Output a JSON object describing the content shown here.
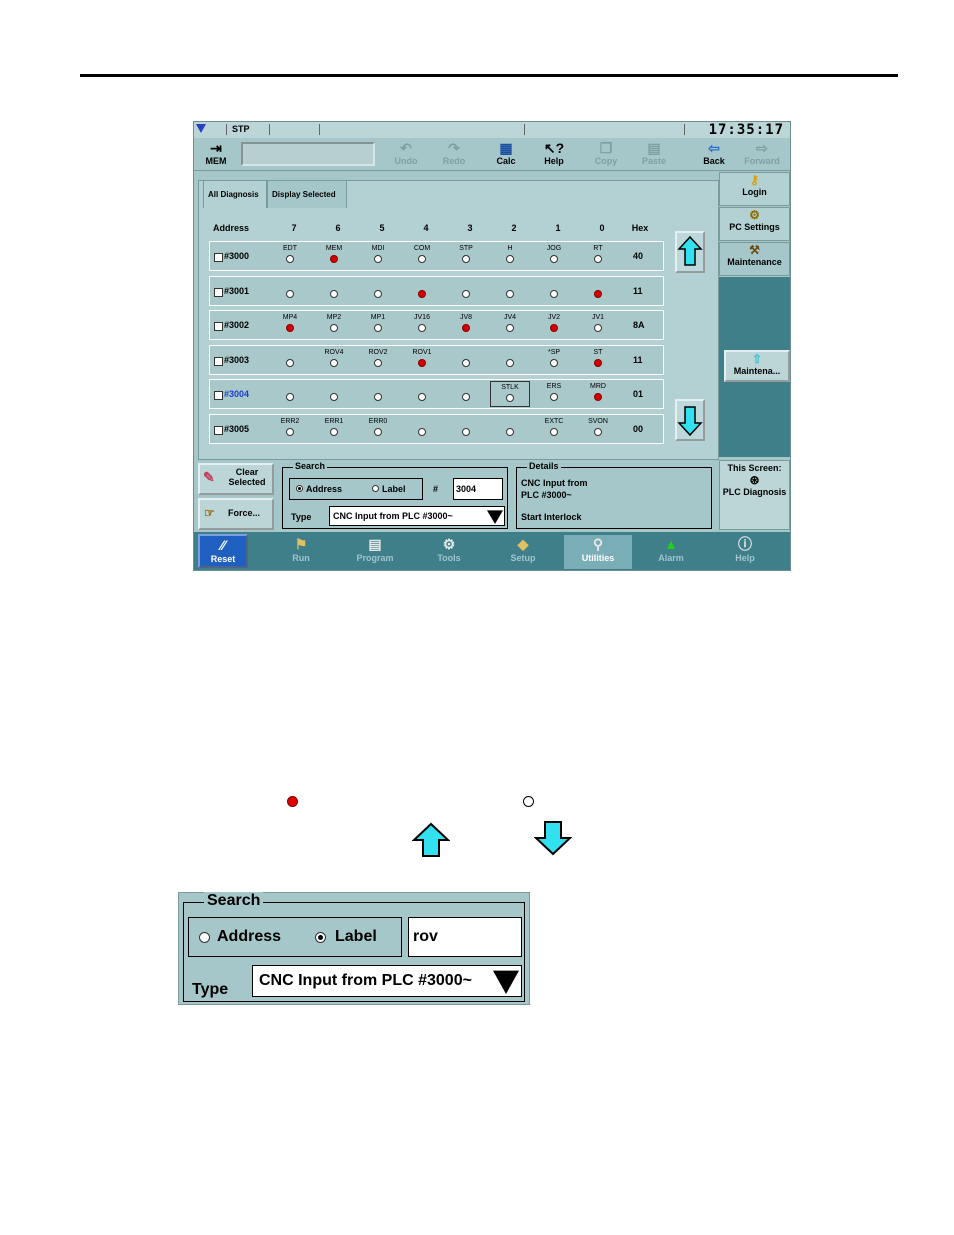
{
  "status": {
    "mode": "STP",
    "clock": "17:35:17"
  },
  "toolbar": {
    "mem": "MEM",
    "undo": "Undo",
    "redo": "Redo",
    "calc": "Calc",
    "help": "Help",
    "copy": "Copy",
    "paste": "Paste",
    "back": "Back",
    "forward": "Forward"
  },
  "tabs": {
    "all": "All Diagnosis",
    "selected": "Display Selected"
  },
  "columns": [
    "Address",
    "7",
    "6",
    "5",
    "4",
    "3",
    "2",
    "1",
    "0",
    "Hex"
  ],
  "rows": [
    {
      "addr": "#3000",
      "hex": "40",
      "bits": [
        {
          "l": "EDT",
          "on": false
        },
        {
          "l": "MEM",
          "on": true
        },
        {
          "l": "MDI",
          "on": false
        },
        {
          "l": "COM",
          "on": false
        },
        {
          "l": "STP",
          "on": false
        },
        {
          "l": "H",
          "on": false
        },
        {
          "l": "JOG",
          "on": false
        },
        {
          "l": "RT",
          "on": false
        }
      ]
    },
    {
      "addr": "#3001",
      "hex": "11",
      "bits": [
        {
          "l": "",
          "on": false
        },
        {
          "l": "",
          "on": false
        },
        {
          "l": "",
          "on": false
        },
        {
          "l": "",
          "on": true
        },
        {
          "l": "",
          "on": false
        },
        {
          "l": "",
          "on": false
        },
        {
          "l": "",
          "on": false
        },
        {
          "l": "",
          "on": true
        }
      ]
    },
    {
      "addr": "#3002",
      "hex": "8A",
      "bits": [
        {
          "l": "MP4",
          "on": true
        },
        {
          "l": "MP2",
          "on": false
        },
        {
          "l": "MP1",
          "on": false
        },
        {
          "l": "JV16",
          "on": false
        },
        {
          "l": "JV8",
          "on": true
        },
        {
          "l": "JV4",
          "on": false
        },
        {
          "l": "JV2",
          "on": true
        },
        {
          "l": "JV1",
          "on": false
        }
      ]
    },
    {
      "addr": "#3003",
      "hex": "11",
      "bits": [
        {
          "l": "",
          "on": false
        },
        {
          "l": "ROV4",
          "on": false
        },
        {
          "l": "ROV2",
          "on": false
        },
        {
          "l": "ROV1",
          "on": true
        },
        {
          "l": "",
          "on": false
        },
        {
          "l": "",
          "on": false
        },
        {
          "l": "*SP",
          "on": false
        },
        {
          "l": "ST",
          "on": true
        }
      ]
    },
    {
      "addr": "#3004",
      "hex": "01",
      "bits": [
        {
          "l": "",
          "on": false
        },
        {
          "l": "",
          "on": false
        },
        {
          "l": "",
          "on": false
        },
        {
          "l": "",
          "on": false
        },
        {
          "l": "",
          "on": false
        },
        {
          "l": "STLK",
          "on": false
        },
        {
          "l": "ERS",
          "on": false
        },
        {
          "l": "MRD",
          "on": true
        }
      ]
    },
    {
      "addr": "#3005",
      "hex": "00",
      "bits": [
        {
          "l": "ERR2",
          "on": false
        },
        {
          "l": "ERR1",
          "on": false
        },
        {
          "l": "ERR0",
          "on": false
        },
        {
          "l": "",
          "on": false
        },
        {
          "l": "",
          "on": false
        },
        {
          "l": "",
          "on": false
        },
        {
          "l": "EXTC",
          "on": false
        },
        {
          "l": "SVON",
          "on": false
        }
      ]
    }
  ],
  "side": {
    "login": "Login",
    "pc_settings": "PC Settings",
    "maintenance": "Maintenance",
    "maint_btn": "Maintena...",
    "this_screen": "This Screen:",
    "plc_diag": "PLC Diagnosis"
  },
  "left": {
    "clear": "Clear Selected",
    "force": "Force..."
  },
  "search": {
    "legend": "Search",
    "address": "Address",
    "label": "Label",
    "hash": "#",
    "value": "3004",
    "type_label": "Type",
    "type_value": "CNC Input from PLC #3000~"
  },
  "details": {
    "legend": "Details",
    "line1": "CNC Input from",
    "line2": "PLC #3000~",
    "line3": "Start Interlock"
  },
  "nav": {
    "reset": "Reset",
    "run": "Run",
    "program": "Program",
    "tools": "Tools",
    "setup": "Setup",
    "utilities": "Utilities",
    "alarm": "Alarm",
    "help": "Help"
  },
  "zoom": {
    "legend": "Search",
    "address": "Address",
    "label": "Label",
    "value": "rov",
    "type_label": "Type",
    "type_value": "CNC Input from PLC #3000~"
  }
}
